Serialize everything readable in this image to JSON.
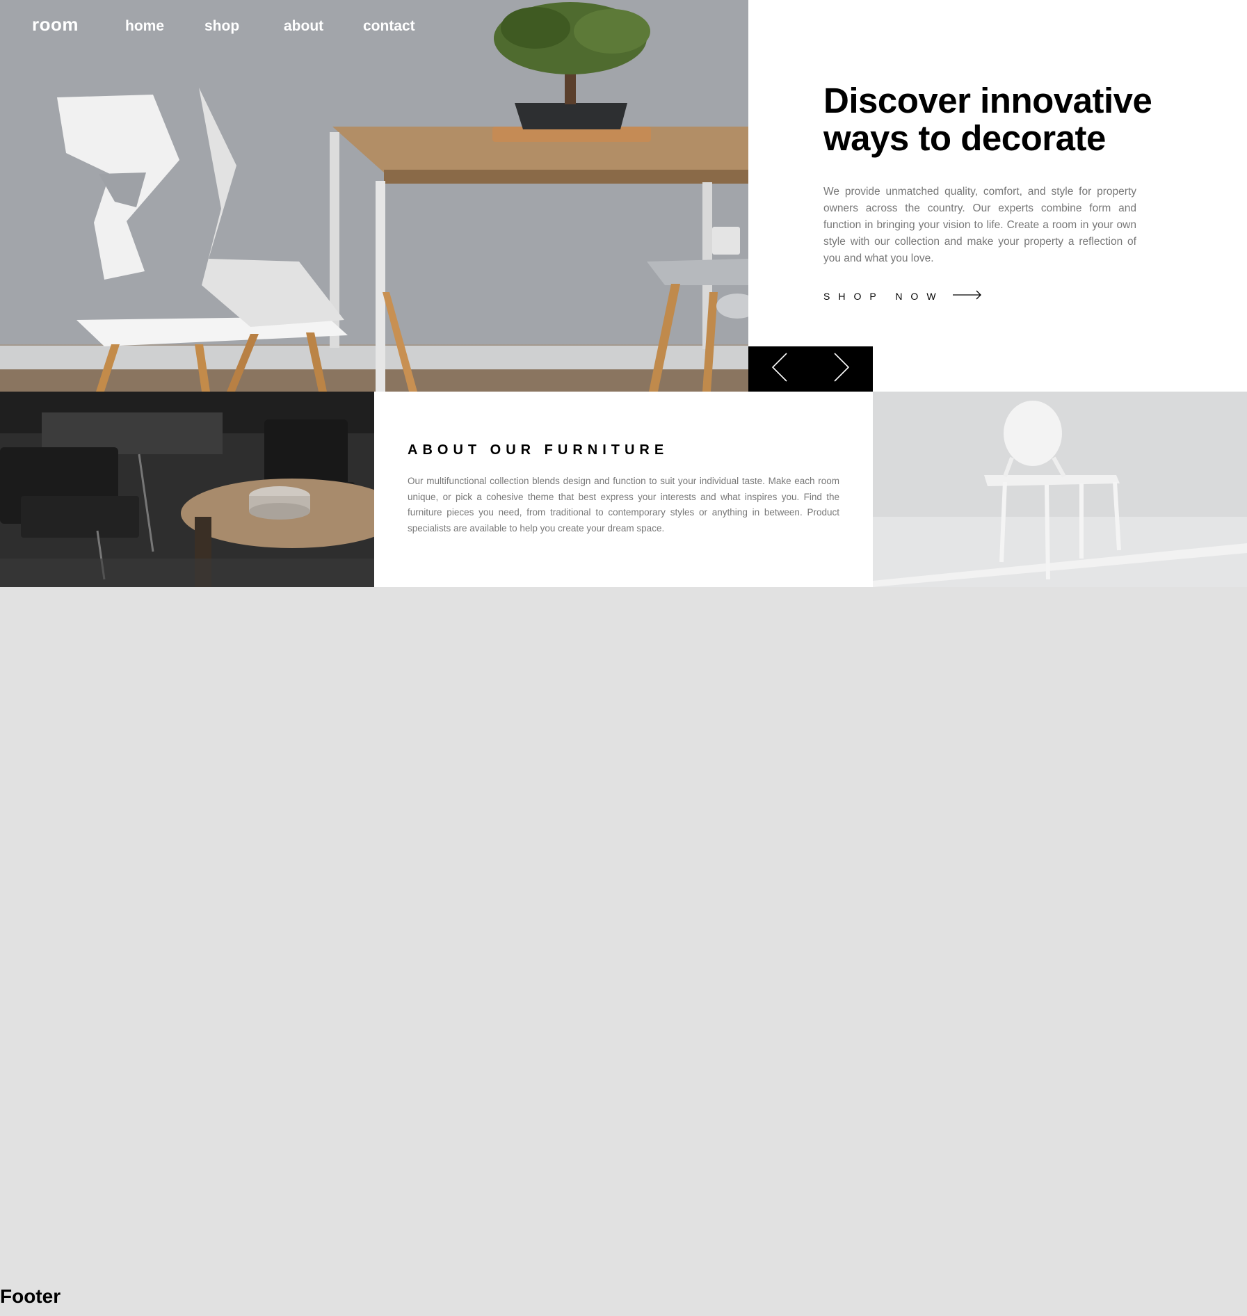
{
  "brand": {
    "logo": "room"
  },
  "nav": {
    "home": "home",
    "shop": "shop",
    "about": "about",
    "contact": "contact"
  },
  "hero": {
    "title_line1": "Discover innovative",
    "title_line2": "ways to decorate",
    "body": "We provide unmatched quality, comfort, and style for property owners across the country. Our experts combine form and function in bringing your vision to life. Create a room in your own style with our collection and make your property a reflection of you and what you love.",
    "cta_label": "SHOP NOW",
    "cta_icon": "arrow-right-icon",
    "prev_icon": "chevron-left-icon",
    "next_icon": "chevron-right-icon"
  },
  "about": {
    "title": "ABOUT OUR FURNITURE",
    "body": "Our multifunctional collection blends design and function to suit your individual taste. Make each room unique, or pick a cohesive theme that best express your interests and what inspires you. Find the furniture pieces you need, from traditional to contemporary styles or anything in between. Product specialists are available to help you create your dream space."
  },
  "footer": {
    "label": "Footer"
  },
  "colors": {
    "page_bg": "#e1e1e1",
    "text_dark": "#000000",
    "text_muted": "#777777",
    "control_bg": "#000000"
  }
}
